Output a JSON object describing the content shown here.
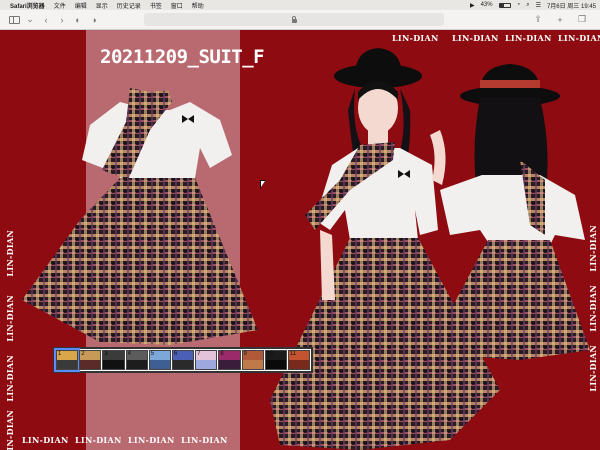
{
  "menubar": {
    "items": [
      "Safari浏览器",
      "文件",
      "编辑",
      "显示",
      "历史记录",
      "书签",
      "窗口",
      "帮助"
    ],
    "battery": "43%",
    "datetime": "7月6日 周三 19:45"
  },
  "canvas": {
    "title": "20211209_SUIT_F",
    "watermark": "LIN-DIAN",
    "background": "#8e0c11",
    "stripe_color": "#b86a70"
  },
  "palette": {
    "swatches": [
      {
        "num": "1",
        "top": "#d9a74a",
        "bottom": "#3a3a3a",
        "selected": true
      },
      {
        "num": "2",
        "top": "#c79a58",
        "bottom": "#5b2b2a",
        "selected": false
      },
      {
        "num": "3",
        "top": "#3b3b3b",
        "bottom": "#111111",
        "selected": false
      },
      {
        "num": "4",
        "top": "#5c5c5c",
        "bottom": "#1d1d1d",
        "selected": false
      },
      {
        "num": "5",
        "top": "#7da6d9",
        "bottom": "#3d5f93",
        "selected": false
      },
      {
        "num": "6",
        "top": "#4a5fb5",
        "bottom": "#2a2a2a",
        "selected": false
      },
      {
        "num": "7",
        "top": "#e3c3d9",
        "bottom": "#9fa7df",
        "selected": false
      },
      {
        "num": "8",
        "top": "#9a2a6a",
        "bottom": "#3a1d3a",
        "selected": false
      },
      {
        "num": "9",
        "top": "#b05a3a",
        "bottom": "#c07a4a",
        "selected": false
      },
      {
        "num": "10",
        "top": "#1b1b1b",
        "bottom": "#0a0a0a",
        "selected": false
      },
      {
        "num": "11",
        "top": "#c4532f",
        "bottom": "#7a2a1a",
        "selected": false
      }
    ]
  }
}
